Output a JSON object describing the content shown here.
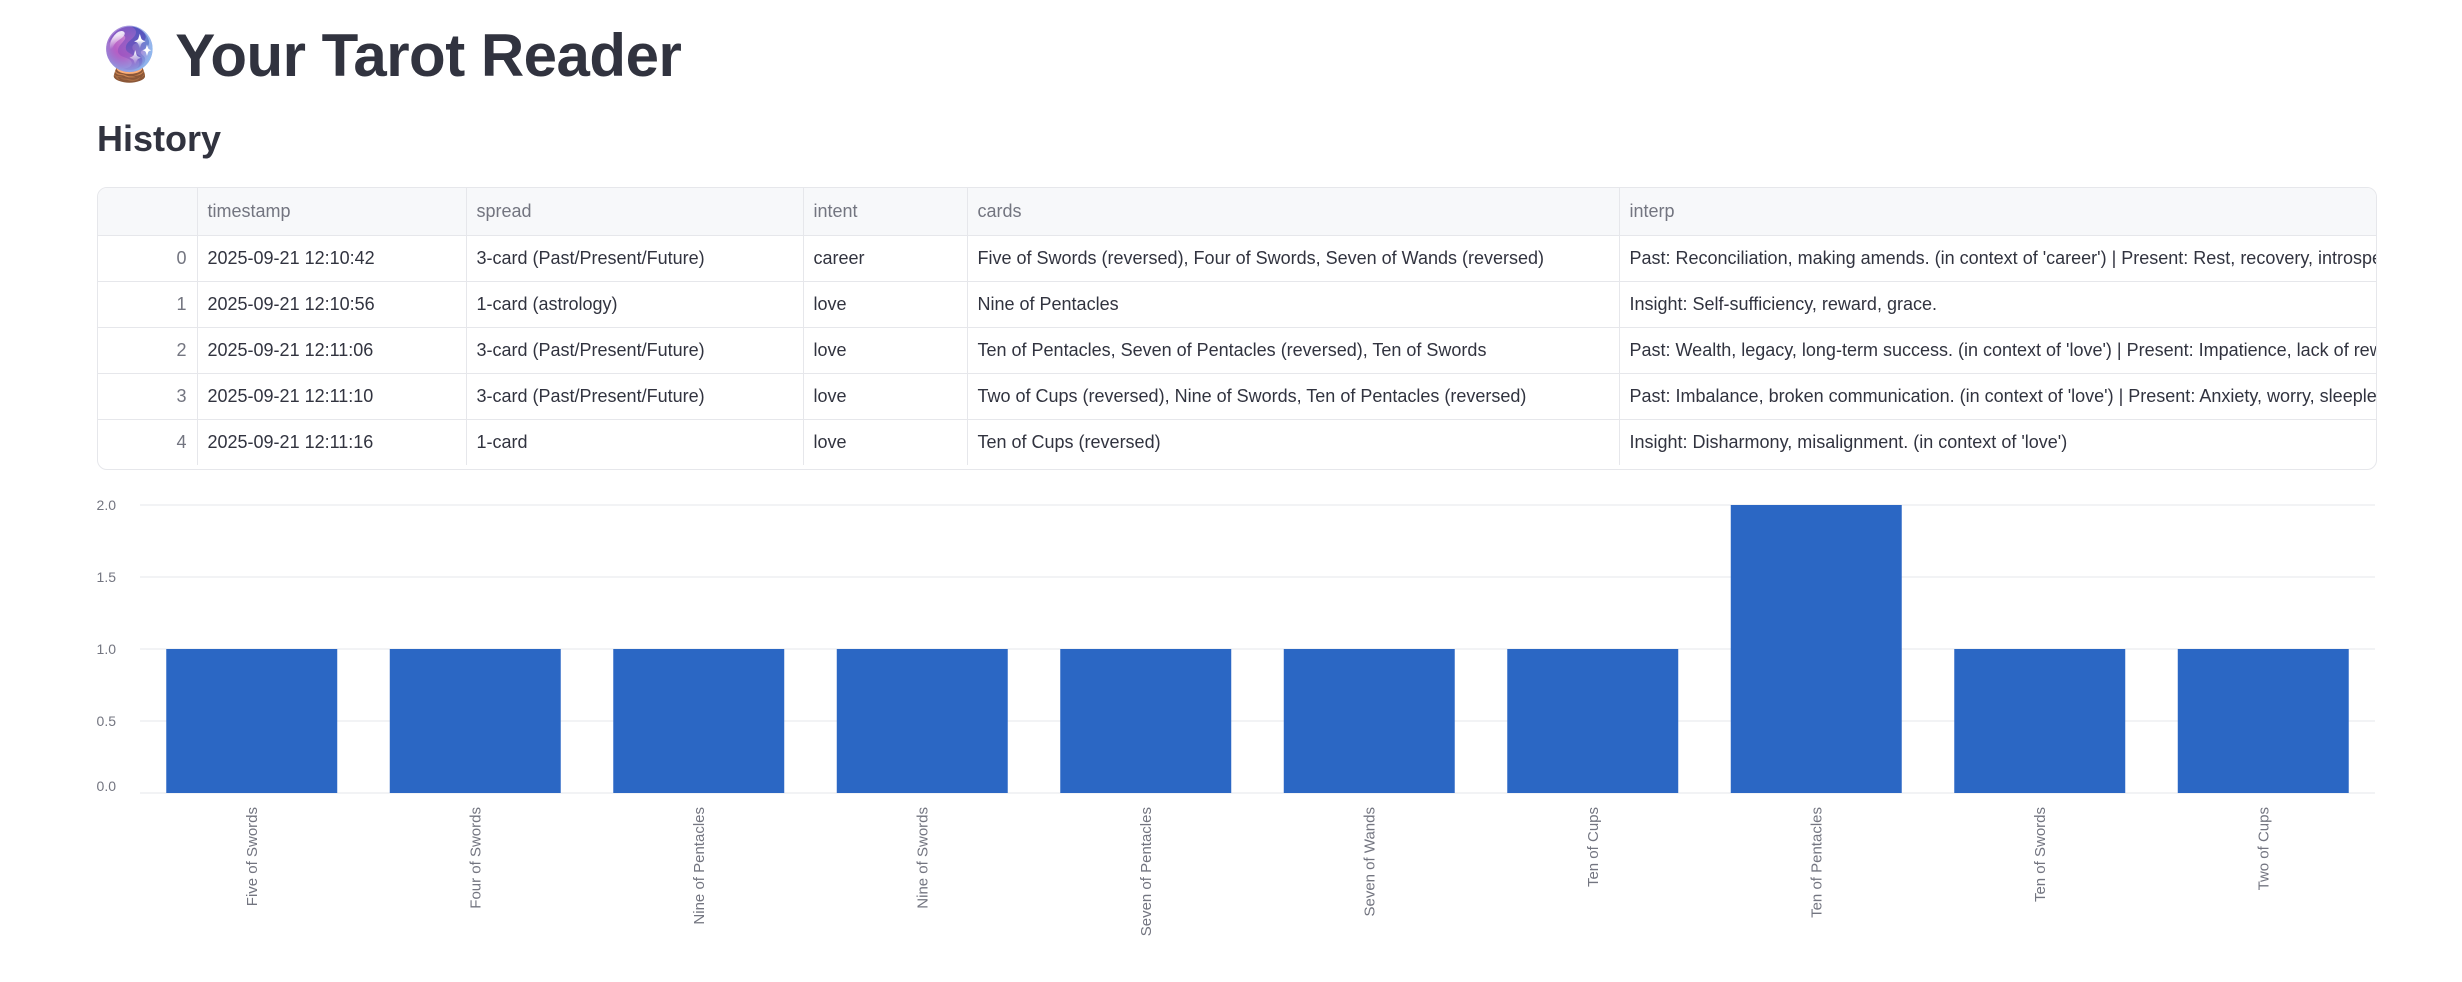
{
  "app": {
    "title_icon": "crystal-ball-icon",
    "title_emoji": "🔮",
    "title": "Your Tarot Reader"
  },
  "history": {
    "heading": "History",
    "columns": [
      "",
      "timestamp",
      "spread",
      "intent",
      "cards",
      "interp"
    ],
    "rows": [
      {
        "index": "0",
        "timestamp": "2025-09-21 12:10:42",
        "spread": "3-card (Past/Present/Future)",
        "intent": "career",
        "cards": "Five of Swords (reversed), Four of Swords, Seven of Wands (reversed)",
        "interp": "Past: Reconciliation, making amends. (in context of 'career') | Present: Rest, recovery, introspectio"
      },
      {
        "index": "1",
        "timestamp": "2025-09-21 12:10:56",
        "spread": "1-card (astrology)",
        "intent": "love",
        "cards": "Nine of Pentacles",
        "interp": "Insight: Self-sufficiency, reward, grace."
      },
      {
        "index": "2",
        "timestamp": "2025-09-21 12:11:06",
        "spread": "3-card (Past/Present/Future)",
        "intent": "love",
        "cards": "Ten of Pentacles, Seven of Pentacles (reversed), Ten of Swords",
        "interp": "Past: Wealth, legacy, long-term success. (in context of 'love') | Present: Impatience, lack of reward."
      },
      {
        "index": "3",
        "timestamp": "2025-09-21 12:11:10",
        "spread": "3-card (Past/Present/Future)",
        "intent": "love",
        "cards": "Two of Cups (reversed), Nine of Swords, Ten of Pentacles (reversed)",
        "interp": "Past: Imbalance, broken communication. (in context of 'love') | Present: Anxiety, worry, sleeplessn"
      },
      {
        "index": "4",
        "timestamp": "2025-09-21 12:11:16",
        "spread": "1-card",
        "intent": "love",
        "cards": "Ten of Cups (reversed)",
        "interp": "Insight: Disharmony, misalignment. (in context of 'love')"
      }
    ]
  },
  "chart_data": {
    "type": "bar",
    "categories": [
      "Five of Swords",
      "Four of Swords",
      "Nine of Pentacles",
      "Nine of Swords",
      "Seven of Pentacles",
      "Seven of Wands",
      "Ten of Cups",
      "Ten of Pentacles",
      "Ten of Swords",
      "Two of Cups"
    ],
    "values": [
      1,
      1,
      1,
      1,
      1,
      1,
      1,
      2,
      1,
      1
    ],
    "y_ticks": [
      "0.0",
      "0.5",
      "1.0",
      "1.5",
      "2.0"
    ],
    "ylim": [
      0,
      2
    ],
    "grid": true,
    "bar_color": "#2b67c4"
  }
}
